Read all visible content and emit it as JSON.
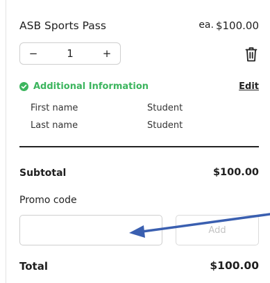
{
  "cart_item": {
    "name": "ASB Sports Pass",
    "price_prefix": "ea.",
    "price": "$100.00",
    "quantity": "1",
    "decrement_symbol": "−",
    "increment_symbol": "+",
    "delete_icon": "trash-icon"
  },
  "additional_info": {
    "label": "Additional Information",
    "edit_label": "Edit",
    "status_icon": "check-circle-icon",
    "status_color": "#3cb55e",
    "fields": [
      {
        "label": "First name",
        "value": "Student"
      },
      {
        "label": "Last name",
        "value": "Student"
      }
    ]
  },
  "summary": {
    "subtotal_label": "Subtotal",
    "subtotal_value": "$100.00",
    "promo_label": "Promo code",
    "promo_value": "",
    "add_button_label": "Add",
    "total_label": "Total",
    "total_value": "$100.00"
  },
  "annotation": {
    "arrow_color": "#3a5fb0",
    "arrow_target": "promo-code-input"
  }
}
